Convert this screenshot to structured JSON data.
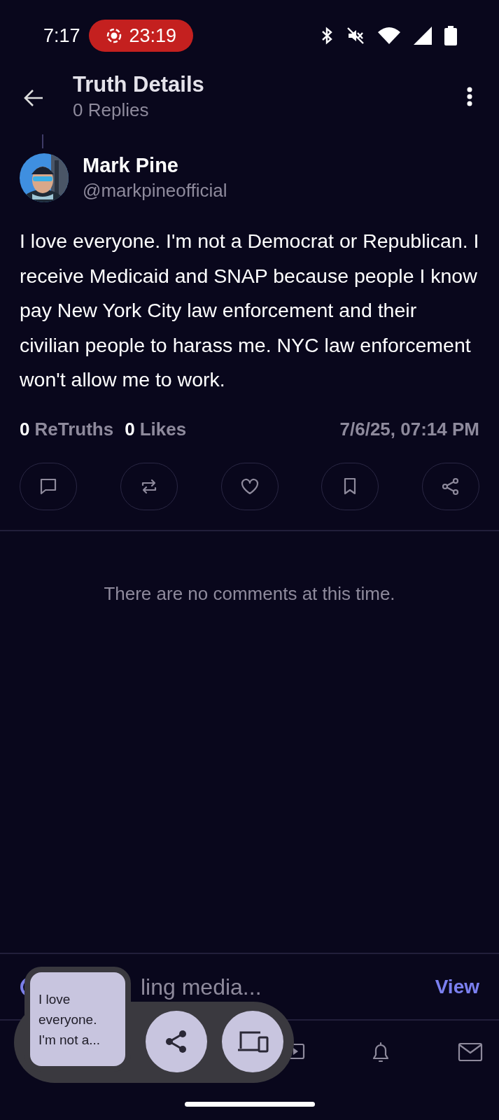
{
  "status_bar": {
    "time": "7:17",
    "recording": "23:19"
  },
  "header": {
    "title": "Truth Details",
    "subtitle": "0 Replies"
  },
  "post": {
    "author": "Mark Pine",
    "handle": "@markpineofficial",
    "text": "I love everyone. I'm not a Democrat or Republican. I receive Medicaid and SNAP because people I know pay New York City law enforcement and their civilian people to harass me. NYC law enforcement won't allow me to work.",
    "retruths_count": "0",
    "retruths_label": "ReTruths",
    "likes_count": "0",
    "likes_label": "Likes",
    "timestamp": "7/6/25, 07:14 PM"
  },
  "comments": {
    "empty_message": "There are no comments at this time."
  },
  "media_bar": {
    "status": "ling media...",
    "action": "View"
  },
  "share_overlay": {
    "preview_text": "I love everyone. I'm not a..."
  }
}
